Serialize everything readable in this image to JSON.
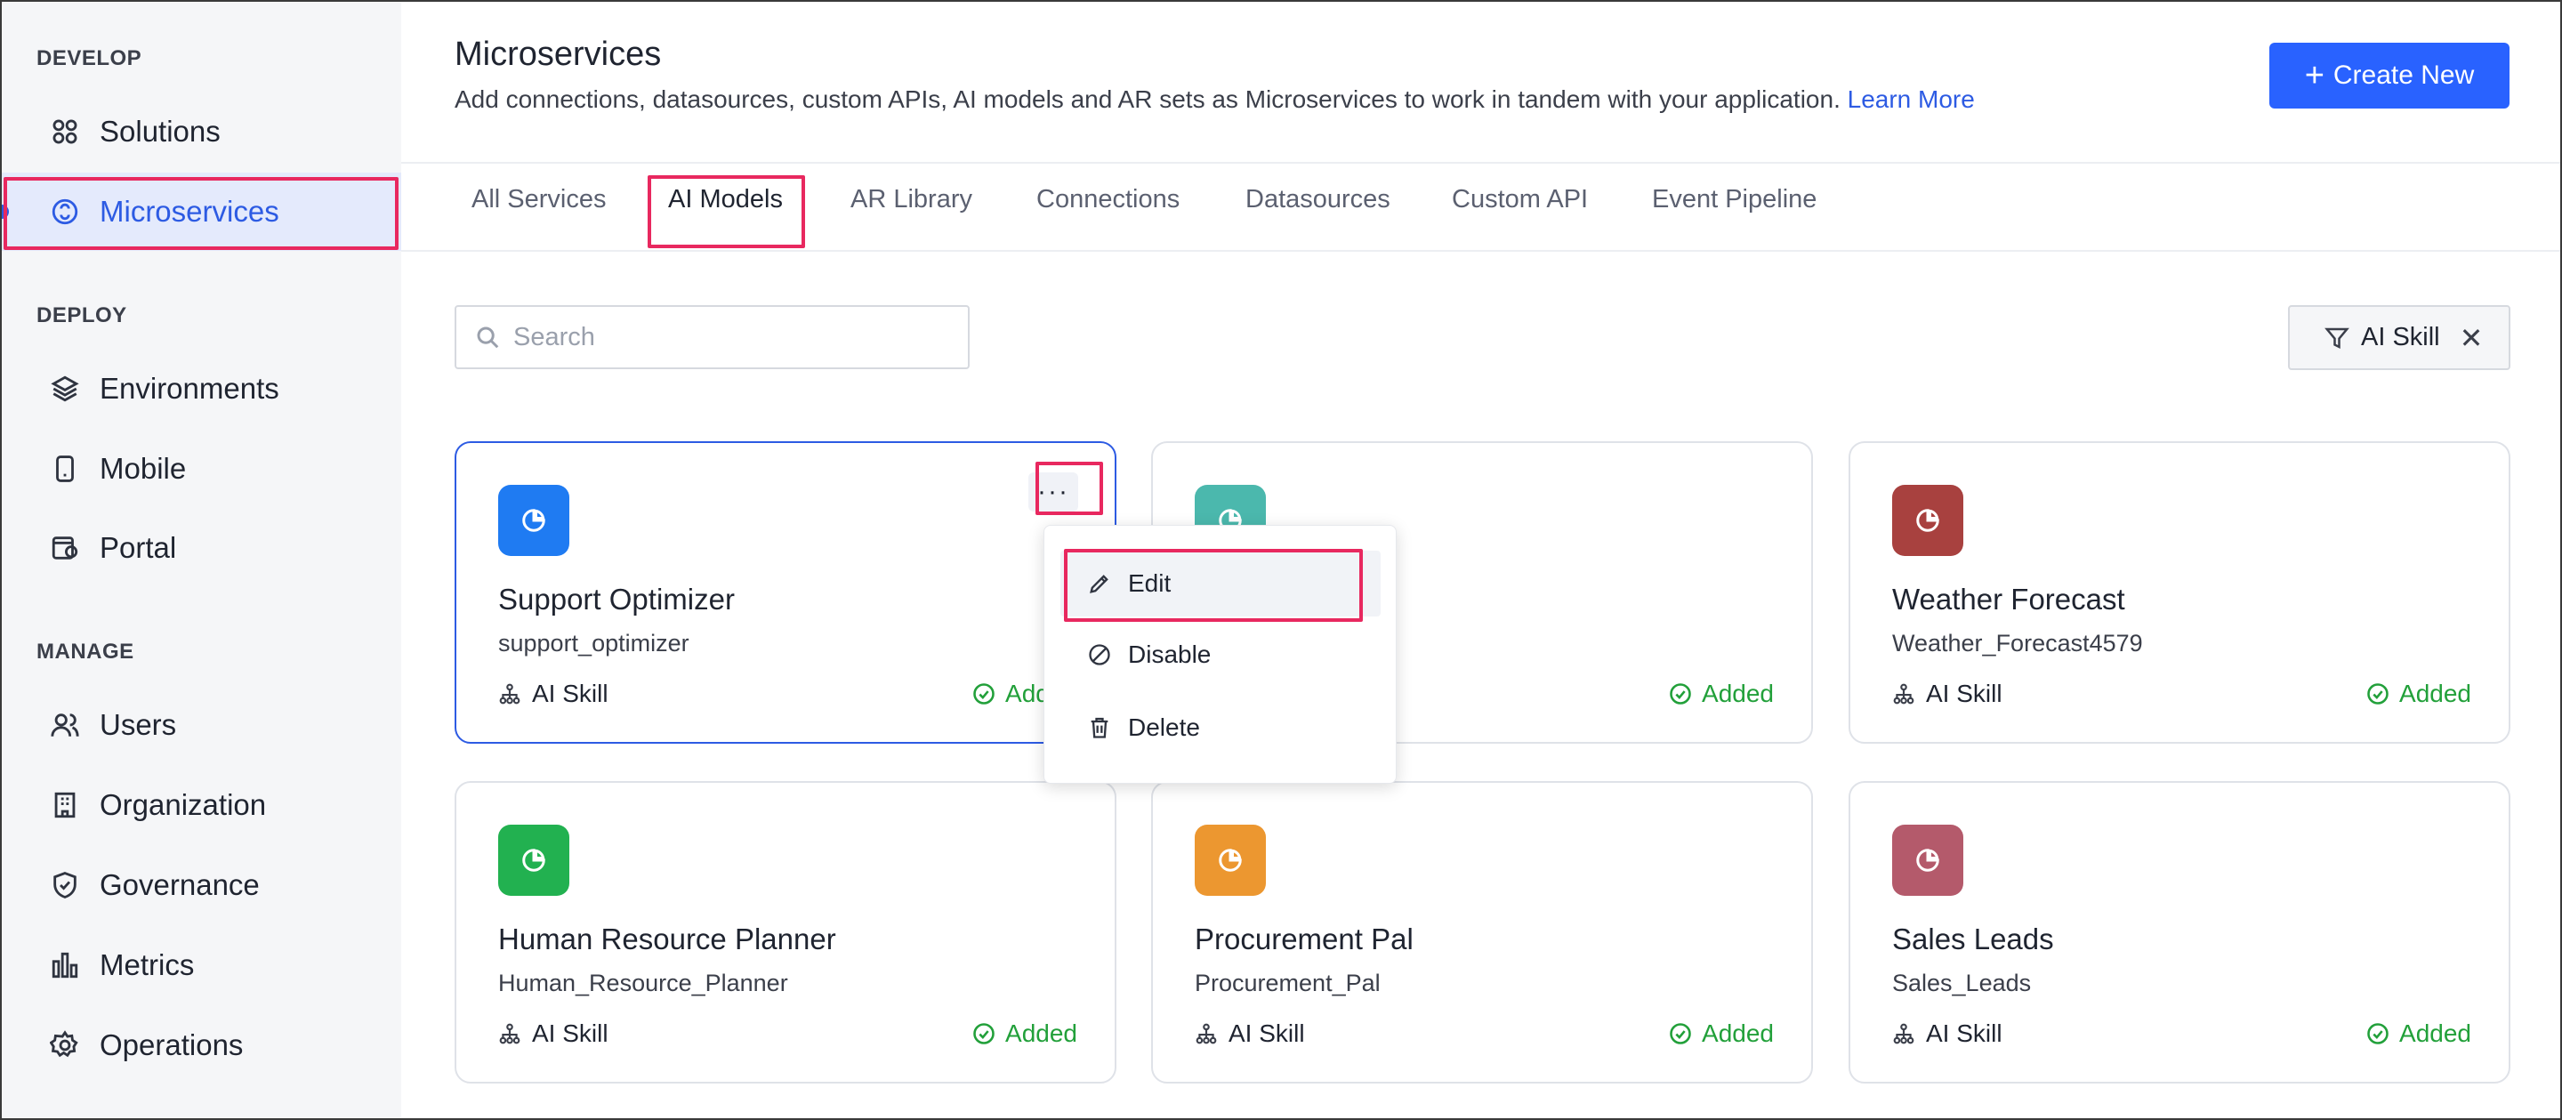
{
  "sidebar": {
    "sections": [
      {
        "label": "DEVELOP"
      },
      {
        "label": "DEPLOY"
      },
      {
        "label": "MANAGE"
      }
    ],
    "items": [
      {
        "label": "Solutions",
        "icon": "grid-icon"
      },
      {
        "label": "Microservices",
        "icon": "microservices-icon",
        "active": true
      },
      {
        "label": "Environments",
        "icon": "layers-icon"
      },
      {
        "label": "Mobile",
        "icon": "mobile-icon"
      },
      {
        "label": "Portal",
        "icon": "portal-icon"
      },
      {
        "label": "Users",
        "icon": "users-icon"
      },
      {
        "label": "Organization",
        "icon": "building-icon"
      },
      {
        "label": "Governance",
        "icon": "shield-icon"
      },
      {
        "label": "Metrics",
        "icon": "bar-chart-icon"
      },
      {
        "label": "Operations",
        "icon": "gear-icon"
      }
    ]
  },
  "header": {
    "title": "Microservices",
    "description": "Add connections, datasources, custom APIs, AI models and AR sets as Microservices to work in tandem with your application.",
    "learn_more": "Learn More",
    "create_button": "Create New"
  },
  "tabs": [
    {
      "label": "All Services"
    },
    {
      "label": "AI Models",
      "active": true
    },
    {
      "label": "AR Library"
    },
    {
      "label": "Connections"
    },
    {
      "label": "Datasources"
    },
    {
      "label": "Custom API"
    },
    {
      "label": "Event Pipeline"
    }
  ],
  "search": {
    "placeholder": "Search"
  },
  "filter": {
    "label": "AI Skill"
  },
  "cards": [
    {
      "name": "Support Optimizer",
      "slug": "support_optimizer",
      "type": "AI Skill",
      "status": "Added",
      "color": "#1f7bf2",
      "selected": true
    },
    {
      "name": "",
      "slug": "",
      "type": "",
      "status": "Added",
      "color": "#4bb8ad"
    },
    {
      "name": "Weather Forecast",
      "slug": "Weather_Forecast4579",
      "type": "AI Skill",
      "status": "Added",
      "color": "#a8413f"
    },
    {
      "name": "Human Resource Planner",
      "slug": "Human_Resource_Planner",
      "type": "AI Skill",
      "status": "Added",
      "color": "#22b150"
    },
    {
      "name": "Procurement Pal",
      "slug": "Procurement_Pal",
      "type": "AI Skill",
      "status": "Added",
      "color": "#ec9730"
    },
    {
      "name": "Sales Leads",
      "slug": "Sales_Leads",
      "type": "AI Skill",
      "status": "Added",
      "color": "#b45a6b"
    }
  ],
  "context_menu": {
    "items": [
      {
        "label": "Edit",
        "icon": "pencil-icon"
      },
      {
        "label": "Disable",
        "icon": "disable-icon"
      },
      {
        "label": "Delete",
        "icon": "trash-icon"
      }
    ]
  },
  "colors": {
    "accent": "#2962ff",
    "highlight": "#e8285f",
    "status_added": "#22a03a"
  }
}
